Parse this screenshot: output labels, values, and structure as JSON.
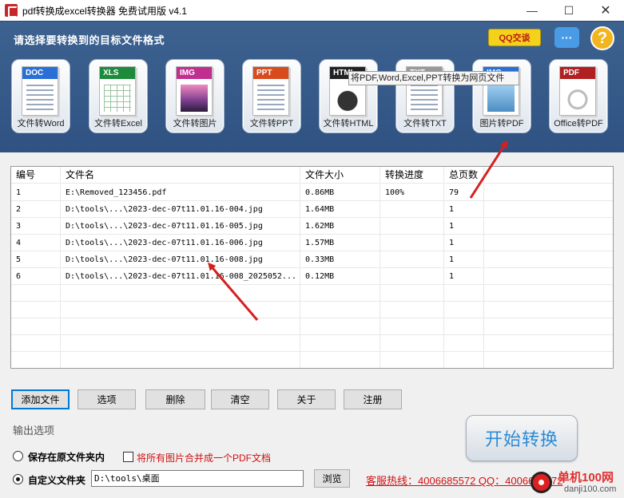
{
  "window": {
    "title": "pdf转换成excel转换器 免费试用版 v4.1",
    "minimize": "—",
    "maximize": "☐",
    "close": "✕"
  },
  "header": {
    "title": "请选择要转换到的目标文件格式",
    "qq_label": "QQ交谈",
    "chat_icon": "···",
    "help_icon": "?"
  },
  "formats": [
    {
      "tag": "DOC",
      "label": "文件转Word",
      "color": "#2a6fd6"
    },
    {
      "tag": "XLS",
      "label": "文件转Excel",
      "color": "#1e8a3c"
    },
    {
      "tag": "IMG",
      "label": "文件转图片",
      "color": "#c02f8f"
    },
    {
      "tag": "PPT",
      "label": "文件转PPT",
      "color": "#d84b1f"
    },
    {
      "tag": "HTML",
      "label": "文件转HTML",
      "color": "#222222"
    },
    {
      "tag": "TXT",
      "label": "文件转TXT",
      "color": "#777777"
    },
    {
      "tag": "IMG",
      "label": "图片转PDF",
      "color": "#2a6fd6"
    },
    {
      "tag": "PDF",
      "label": "Office转PDF",
      "color": "#b02020"
    }
  ],
  "tooltip": "将PDF,Word,Excel,PPT转换为网页文件",
  "table": {
    "headers": [
      "编号",
      "文件名",
      "文件大小",
      "转换进度",
      "总页数"
    ],
    "rows": [
      [
        "1",
        "E:\\Removed_123456.pdf",
        "0.86MB",
        "100%",
        "79"
      ],
      [
        "2",
        "D:\\tools\\...\\2023-dec-07t11.01.16-004.jpg",
        "1.64MB",
        "",
        "1"
      ],
      [
        "3",
        "D:\\tools\\...\\2023-dec-07t11.01.16-005.jpg",
        "1.62MB",
        "",
        "1"
      ],
      [
        "4",
        "D:\\tools\\...\\2023-dec-07t11.01.16-006.jpg",
        "1.57MB",
        "",
        "1"
      ],
      [
        "5",
        "D:\\tools\\...\\2023-dec-07t11.01.16-008.jpg",
        "0.33MB",
        "",
        "1"
      ],
      [
        "6",
        "D:\\tools\\...\\2023-dec-07t11.01.16-008_2025052...",
        "0.12MB",
        "",
        "1"
      ]
    ]
  },
  "actions": {
    "add": "添加文件",
    "options": "选项",
    "delete": "删除",
    "clear": "清空",
    "about": "关于",
    "register": "注册"
  },
  "output": {
    "section": "输出选项",
    "keep_original": "保存在原文件夹内",
    "merge": "将所有图片合并成一个PDF文档",
    "custom_folder": "自定义文件夹",
    "path": "D:\\tools\\桌面",
    "browse": "浏览"
  },
  "start": "开始转换",
  "hotline": "客服热线：4006685572 QQ：4006685572",
  "watermark": {
    "line1": "单机100网",
    "line2": "danji100.com"
  },
  "colors": {
    "header": "#2f5282",
    "accent": "#2a8bd6",
    "arrow": "#d42020"
  }
}
